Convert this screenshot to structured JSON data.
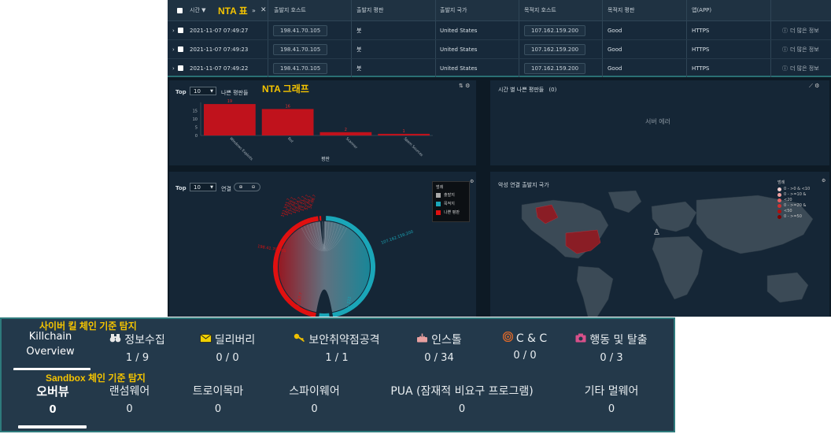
{
  "nta_table": {
    "overlay_label": "NTA 표",
    "header": {
      "time": "시간 ▼",
      "src_host": "출발지 호스트",
      "src_rep": "출발지 평판",
      "src_country": "출발지 국가",
      "dst_host": "목적지 호스트",
      "dst_rep": "목적지 평판",
      "app": "앱(APP)"
    },
    "rows": [
      {
        "time": "2021-11-07 07:49:27",
        "src_host": "198.41.70.105",
        "src_rep": "봇",
        "src_country": "United States",
        "dst_host": "107.162.159.200",
        "dst_rep": "Good",
        "app": "HTTPS",
        "more": "더 많은 정보"
      },
      {
        "time": "2021-11-07 07:49:23",
        "src_host": "198.41.70.105",
        "src_rep": "봇",
        "src_country": "United States",
        "dst_host": "107.162.159.200",
        "dst_rep": "Good",
        "app": "HTTPS",
        "more": "더 많은 정보"
      },
      {
        "time": "2021-11-07 07:49:22",
        "src_host": "198.41.70.105",
        "src_rep": "봇",
        "src_country": "United States",
        "dst_host": "107.162.159.200",
        "dst_rep": "Good",
        "app": "HTTPS",
        "more": "더 많은 정보"
      }
    ]
  },
  "nta_graph": {
    "overlay_label": "NTA 그래프",
    "bad_rep_panel": {
      "top_label": "Top",
      "top_value": "10",
      "title": "나쁜 평판들",
      "xlabel": "평판"
    },
    "time_panel": {
      "title": "시간 별 나쁜 평판들",
      "count": "(0)",
      "error": "서버 에러"
    },
    "conn_panel": {
      "top_label": "Top",
      "top_value": "10",
      "title": "연결",
      "legend_title": "범례",
      "legend": [
        {
          "label": "출발지",
          "color": "#aaaaaa"
        },
        {
          "label": "목적지",
          "color": "#1aa6b8"
        },
        {
          "label": "나쁜 평판",
          "color": "#e01010"
        }
      ],
      "dst_ip": "107.162.159.200",
      "src_ip": "198.41.70.105",
      "bottom_left_ip": "172.67.?",
      "bottom_right_ip": "52.222"
    },
    "map_panel": {
      "title": "악성 연결 출발지 국가",
      "legend_title": "범례",
      "legend": [
        "0 - >0 & <10",
        "0 - >=10 &",
        "<20",
        "0 - >=20 &",
        "<50",
        "0 - >=50"
      ]
    }
  },
  "chart_data": {
    "type": "bar",
    "title": "나쁜 평판들",
    "xlabel": "평판",
    "categories": [
      "Windows Exploits",
      "Bot",
      "Scanner",
      "Spam Sources"
    ],
    "values": [
      19,
      16,
      2,
      1
    ],
    "ylim": [
      0,
      20
    ],
    "yticks": [
      0,
      5,
      10,
      15
    ],
    "color": "#c0121c"
  },
  "killchain": {
    "overlay_label": "사이버 킬 체인 기준 탐지",
    "overview_line1": "Killchain",
    "overview_line2": "Overview",
    "stages": [
      {
        "label": "정보수집",
        "value": "1 / 9"
      },
      {
        "label": "딜리버리",
        "value": "0 / 0"
      },
      {
        "label": "보안취약점공격",
        "value": "1 / 1"
      },
      {
        "label": "인스톨",
        "value": "0 / 34"
      },
      {
        "label": "C & C",
        "value": "0 / 0"
      },
      {
        "label": "행동 및 탈출",
        "value": "0 / 3"
      }
    ]
  },
  "sandbox": {
    "overlay_label": "Sandbox 체인 기준 탐지",
    "tabs": [
      {
        "label": "오버뷰",
        "value": "0"
      },
      {
        "label": "랜섬웨어",
        "value": "0"
      },
      {
        "label": "트로이목마",
        "value": "0"
      },
      {
        "label": "스파이웨어",
        "value": "0"
      },
      {
        "label": "PUA (잠재적 비요구 프로그램)",
        "value": "0"
      },
      {
        "label": "기타 멀웨어",
        "value": "0"
      }
    ]
  }
}
